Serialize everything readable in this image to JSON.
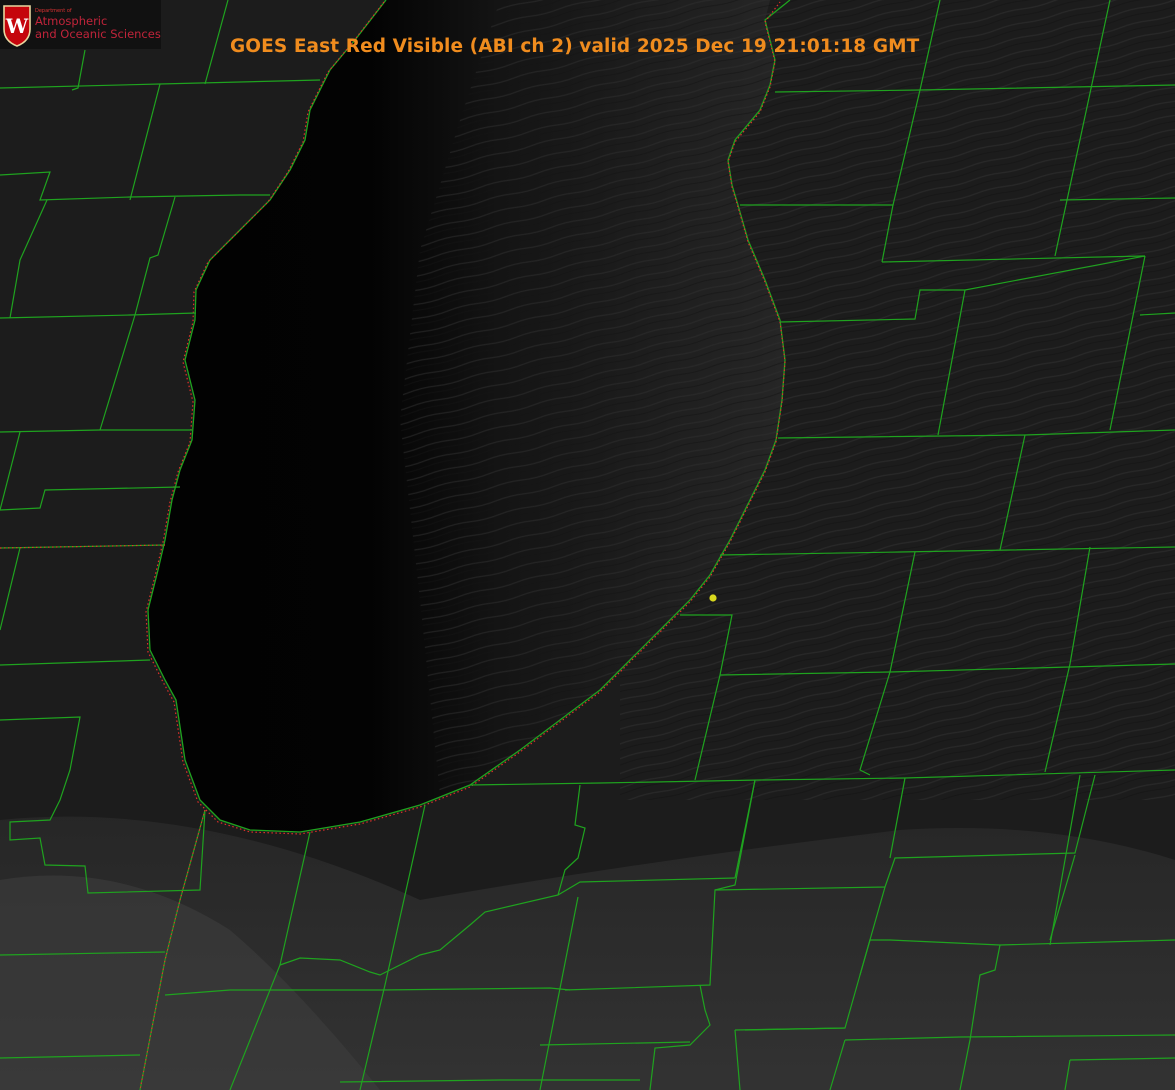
{
  "image": {
    "title": "GOES East Red Visible (ABI ch 2) valid 2025 Dec 19 21:01:18 GMT",
    "logo": {
      "department_label": "Department of",
      "line1": "Atmospheric",
      "line2": "and Oceanic Sciences",
      "letter": "W"
    },
    "colors": {
      "title": "#f08c1e",
      "county_lines": "#1fa31f",
      "coastline": "#e0302a",
      "marker": "#d8d81e",
      "lake": "#050505",
      "land": "#1c1c1c"
    }
  }
}
